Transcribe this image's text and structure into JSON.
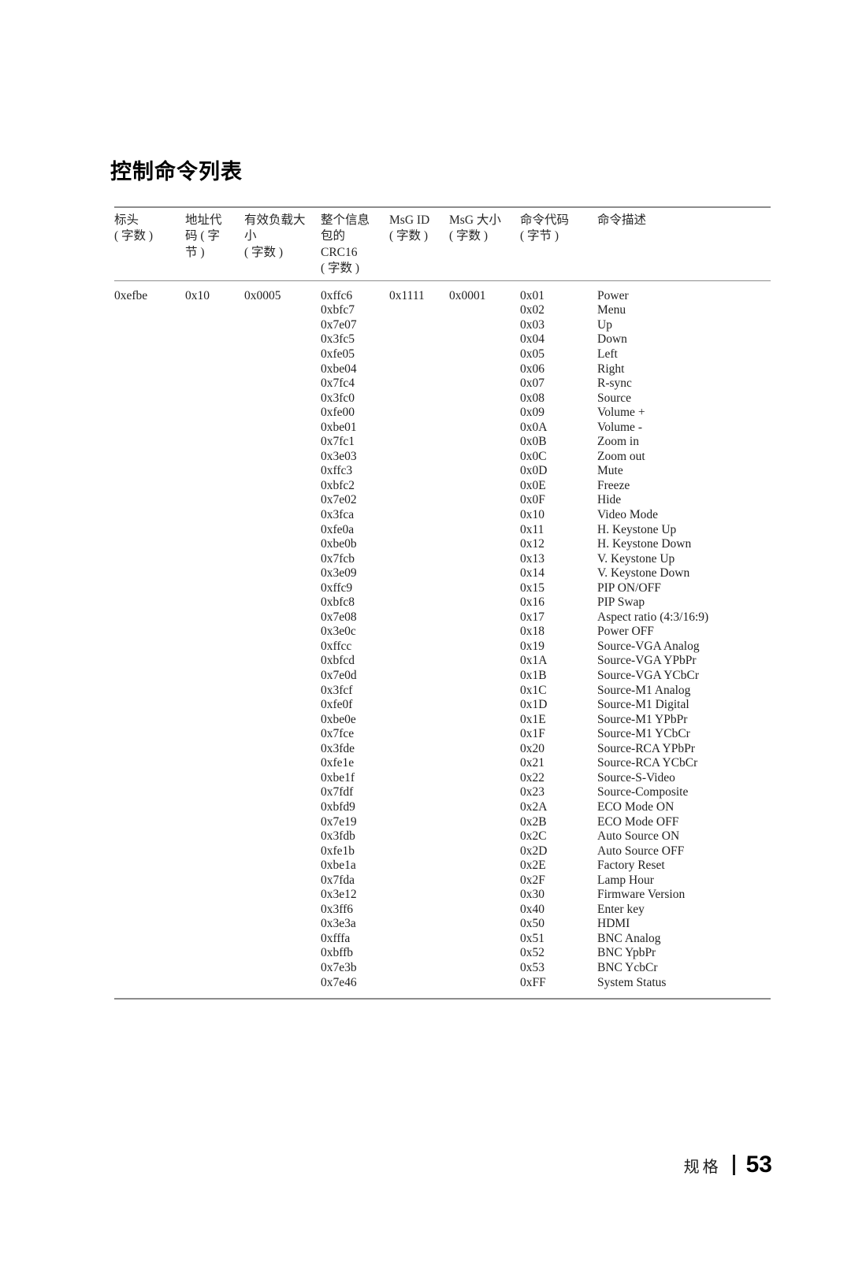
{
  "document": {
    "title": "控制命令列表",
    "footer": {
      "section_label": "规格",
      "page_number": "53"
    }
  },
  "table": {
    "columns": [
      {
        "key": "header",
        "lines": [
          "标头",
          "( 字数 )"
        ]
      },
      {
        "key": "address",
        "lines": [
          "地址代",
          "码 ( 字",
          "节 )"
        ]
      },
      {
        "key": "payload",
        "lines": [
          "有效负载大",
          "小",
          "( 字数 )"
        ]
      },
      {
        "key": "crc",
        "lines": [
          "整个信息",
          "包的",
          "CRC16",
          "( 字数 )"
        ]
      },
      {
        "key": "msgid",
        "lines": [
          "MsG ID",
          "( 字数 )"
        ]
      },
      {
        "key": "msgsize",
        "lines": [
          "MsG 大小",
          "( 字数 )"
        ]
      },
      {
        "key": "cmdcode",
        "lines": [
          "命令代码",
          "( 字节 )"
        ]
      },
      {
        "key": "cmddesc",
        "lines": [
          "命令描述"
        ]
      }
    ],
    "single_values": {
      "header": "0xefbe",
      "address": "0x10",
      "payload": "0x0005",
      "msgid": "0x1111",
      "msgsize": "0x0001"
    },
    "rows": [
      {
        "crc": "0xffc6",
        "code": "0x01",
        "desc": "Power"
      },
      {
        "crc": "0xbfc7",
        "code": "0x02",
        "desc": "Menu"
      },
      {
        "crc": "0x7e07",
        "code": "0x03",
        "desc": "Up"
      },
      {
        "crc": "0x3fc5",
        "code": "0x04",
        "desc": "Down"
      },
      {
        "crc": "0xfe05",
        "code": "0x05",
        "desc": "Left"
      },
      {
        "crc": "0xbe04",
        "code": "0x06",
        "desc": "Right"
      },
      {
        "crc": "0x7fc4",
        "code": "0x07",
        "desc": "R-sync"
      },
      {
        "crc": "0x3fc0",
        "code": "0x08",
        "desc": "Source"
      },
      {
        "crc": "0xfe00",
        "code": "0x09",
        "desc": "Volume +"
      },
      {
        "crc": "0xbe01",
        "code": "0x0A",
        "desc": "Volume -"
      },
      {
        "crc": "0x7fc1",
        "code": "0x0B",
        "desc": "Zoom in"
      },
      {
        "crc": "0x3e03",
        "code": "0x0C",
        "desc": "Zoom out"
      },
      {
        "crc": "0xffc3",
        "code": "0x0D",
        "desc": "Mute"
      },
      {
        "crc": "0xbfc2",
        "code": "0x0E",
        "desc": "Freeze"
      },
      {
        "crc": "0x7e02",
        "code": "0x0F",
        "desc": "Hide"
      },
      {
        "crc": "0x3fca",
        "code": "0x10",
        "desc": "Video Mode"
      },
      {
        "crc": "0xfe0a",
        "code": "0x11",
        "desc": "H. Keystone Up"
      },
      {
        "crc": "0xbe0b",
        "code": "0x12",
        "desc": "H. Keystone Down"
      },
      {
        "crc": "0x7fcb",
        "code": "0x13",
        "desc": "V. Keystone Up"
      },
      {
        "crc": "0x3e09",
        "code": "0x14",
        "desc": "V. Keystone Down"
      },
      {
        "crc": "0xffc9",
        "code": "0x15",
        "desc": "PIP ON/OFF"
      },
      {
        "crc": "0xbfc8",
        "code": "0x16",
        "desc": "PIP Swap"
      },
      {
        "crc": "0x7e08",
        "code": "0x17",
        "desc": "Aspect ratio (4:3/16:9)"
      },
      {
        "crc": "0x3e0c",
        "code": "0x18",
        "desc": "Power OFF"
      },
      {
        "crc": "0xffcc",
        "code": "0x19",
        "desc": "Source-VGA Analog"
      },
      {
        "crc": "0xbfcd",
        "code": "0x1A",
        "desc": "Source-VGA YPbPr"
      },
      {
        "crc": "0x7e0d",
        "code": "0x1B",
        "desc": "Source-VGA YCbCr"
      },
      {
        "crc": "0x3fcf",
        "code": "0x1C",
        "desc": "Source-M1 Analog"
      },
      {
        "crc": "0xfe0f",
        "code": "0x1D",
        "desc": "Source-M1 Digital"
      },
      {
        "crc": "0xbe0e",
        "code": "0x1E",
        "desc": "Source-M1 YPbPr"
      },
      {
        "crc": "0x7fce",
        "code": "0x1F",
        "desc": "Source-M1 YCbCr"
      },
      {
        "crc": "0x3fde",
        "code": "0x20",
        "desc": "Source-RCA YPbPr"
      },
      {
        "crc": "0xfe1e",
        "code": "0x21",
        "desc": "Source-RCA YCbCr"
      },
      {
        "crc": "0xbe1f",
        "code": "0x22",
        "desc": "Source-S-Video"
      },
      {
        "crc": "0x7fdf",
        "code": "0x23",
        "desc": "Source-Composite"
      },
      {
        "crc": "0xbfd9",
        "code": "0x2A",
        "desc": "ECO Mode ON"
      },
      {
        "crc": "0x7e19",
        "code": "0x2B",
        "desc": "ECO Mode OFF"
      },
      {
        "crc": "0x3fdb",
        "code": "0x2C",
        "desc": "Auto Source ON"
      },
      {
        "crc": "0xfe1b",
        "code": "0x2D",
        "desc": "Auto Source OFF"
      },
      {
        "crc": "0xbe1a",
        "code": "0x2E",
        "desc": "Factory Reset"
      },
      {
        "crc": "0x7fda",
        "code": "0x2F",
        "desc": "Lamp Hour"
      },
      {
        "crc": "0x3e12",
        "code": "0x30",
        "desc": "Firmware Version"
      },
      {
        "crc": "0x3ff6",
        "code": "0x40",
        "desc": "Enter key"
      },
      {
        "crc": "0x3e3a",
        "code": "0x50",
        "desc": "HDMI"
      },
      {
        "crc": "0xfffa",
        "code": "0x51",
        "desc": "BNC Analog"
      },
      {
        "crc": "0xbffb",
        "code": "0x52",
        "desc": "BNC YpbPr"
      },
      {
        "crc": "0x7e3b",
        "code": "0x53",
        "desc": "BNC YcbCr"
      },
      {
        "crc": "0x7e46",
        "code": "0xFF",
        "desc": "System Status"
      }
    ]
  }
}
